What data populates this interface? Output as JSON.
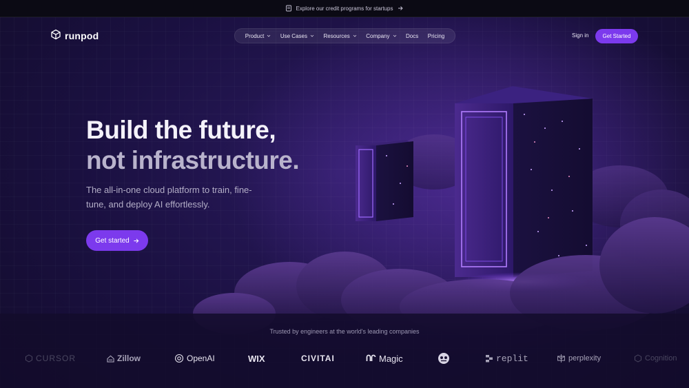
{
  "announcement": {
    "text": "Explore our credit programs for startups"
  },
  "brand": {
    "name": "runpod"
  },
  "nav": {
    "items": [
      {
        "label": "Product",
        "dropdown": true
      },
      {
        "label": "Use Cases",
        "dropdown": true
      },
      {
        "label": "Resources",
        "dropdown": true
      },
      {
        "label": "Company",
        "dropdown": true
      },
      {
        "label": "Docs",
        "dropdown": false
      },
      {
        "label": "Pricing",
        "dropdown": false
      }
    ],
    "signin": "Sign in",
    "get_started": "Get Started"
  },
  "hero": {
    "headline_line1": "Build the future,",
    "headline_line2": "not infrastructure.",
    "subtitle": "The all-in-one cloud platform to train, fine-tune, and deploy AI effortlessly.",
    "cta": "Get started"
  },
  "trusted": {
    "caption": "Trusted by engineers at the world's leading companies",
    "logos": [
      "CURSOR",
      "Zillow",
      "OpenAI",
      "WIX",
      "CIVITAI",
      "Magic",
      "replit",
      "perplexity",
      "Cognition"
    ]
  },
  "colors": {
    "accent": "#7c3aed",
    "background": "#120c2a"
  }
}
